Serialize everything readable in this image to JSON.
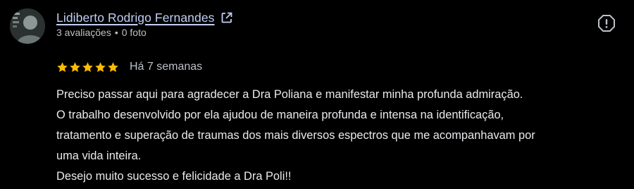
{
  "review": {
    "author": {
      "name": "Lidiberto Rodrigo Fernandes",
      "reviews_count": "3 avaliações",
      "separator": "•",
      "photos_count": "0 foto",
      "avatar_icon": "profile-photo",
      "external_link_icon": "open-in-new-icon"
    },
    "report_icon": "report-flag-icon",
    "rating": {
      "stars": 5,
      "max": 5,
      "color": "#fbbc04"
    },
    "date": "Há 7 semanas",
    "text_lines": [
      "Preciso passar aqui para agradecer a Dra Poliana e manifestar minha profunda admiração.",
      "O trabalho desenvolvido por ela ajudou de maneira profunda e intensa na identificação,",
      "tratamento e superação de traumas dos mais diversos espectros que me acompanhavam por",
      "uma vida inteira.",
      "Desejo muito sucesso e felicidade a Dra Poli!!"
    ]
  },
  "colors": {
    "background": "#000000",
    "author_link": "#c2cff5",
    "secondary_text": "#bdc1c6",
    "body_text": "#e8eaed"
  }
}
